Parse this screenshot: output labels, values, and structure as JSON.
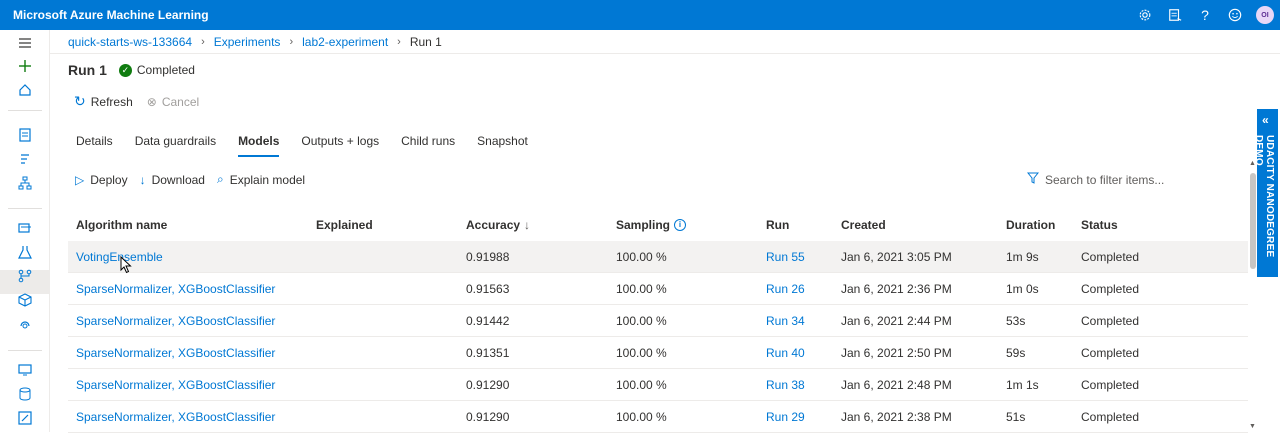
{
  "app": {
    "title": "Microsoft Azure Machine Learning",
    "avatar_initials": "OI"
  },
  "topbar_icons": [
    "gear-icon",
    "feedback-icon",
    "help-icon",
    "smiley-icon"
  ],
  "breadcrumb": [
    {
      "label": "quick-starts-ws-133664"
    },
    {
      "label": "Experiments"
    },
    {
      "label": "lab2-experiment"
    },
    {
      "label": "Run 1"
    }
  ],
  "run": {
    "title": "Run 1",
    "status": "Completed"
  },
  "commands": {
    "refresh": "Refresh",
    "cancel": "Cancel"
  },
  "tabs": [
    {
      "label": "Details"
    },
    {
      "label": "Data guardrails"
    },
    {
      "label": "Models",
      "active": true
    },
    {
      "label": "Outputs + logs"
    },
    {
      "label": "Child runs"
    },
    {
      "label": "Snapshot"
    }
  ],
  "actions": {
    "deploy": "Deploy",
    "download": "Download",
    "explain": "Explain model"
  },
  "search": {
    "placeholder": "Search to filter items..."
  },
  "table": {
    "headers": {
      "algorithm": "Algorithm name",
      "explained": "Explained",
      "accuracy": "Accuracy",
      "accuracy_sort": "↓",
      "sampling": "Sampling",
      "run": "Run",
      "created": "Created",
      "duration": "Duration",
      "status": "Status"
    },
    "rows": [
      {
        "algorithm": "VotingEnsemble",
        "explained": "",
        "accuracy": "0.91988",
        "sampling": "100.00 %",
        "run": "Run 55",
        "created": "Jan 6, 2021 3:05 PM",
        "duration": "1m 9s",
        "status": "Completed"
      },
      {
        "algorithm": "SparseNormalizer, XGBoostClassifier",
        "explained": "",
        "accuracy": "0.91563",
        "sampling": "100.00 %",
        "run": "Run 26",
        "created": "Jan 6, 2021 2:36 PM",
        "duration": "1m 0s",
        "status": "Completed"
      },
      {
        "algorithm": "SparseNormalizer, XGBoostClassifier",
        "explained": "",
        "accuracy": "0.91442",
        "sampling": "100.00 %",
        "run": "Run 34",
        "created": "Jan 6, 2021 2:44 PM",
        "duration": "53s",
        "status": "Completed"
      },
      {
        "algorithm": "SparseNormalizer, XGBoostClassifier",
        "explained": "",
        "accuracy": "0.91351",
        "sampling": "100.00 %",
        "run": "Run 40",
        "created": "Jan 6, 2021 2:50 PM",
        "duration": "59s",
        "status": "Completed"
      },
      {
        "algorithm": "SparseNormalizer, XGBoostClassifier",
        "explained": "",
        "accuracy": "0.91290",
        "sampling": "100.00 %",
        "run": "Run 38",
        "created": "Jan 6, 2021 2:48 PM",
        "duration": "1m 1s",
        "status": "Completed"
      },
      {
        "algorithm": "SparseNormalizer, XGBoostClassifier",
        "explained": "",
        "accuracy": "0.91290",
        "sampling": "100.00 %",
        "run": "Run 29",
        "created": "Jan 6, 2021 2:38 PM",
        "duration": "51s",
        "status": "Completed"
      }
    ]
  },
  "side_panel": {
    "label": "UDACITY NANODEGREE DEMO"
  },
  "colors": {
    "accent": "#0078d4",
    "success": "#107c10"
  }
}
